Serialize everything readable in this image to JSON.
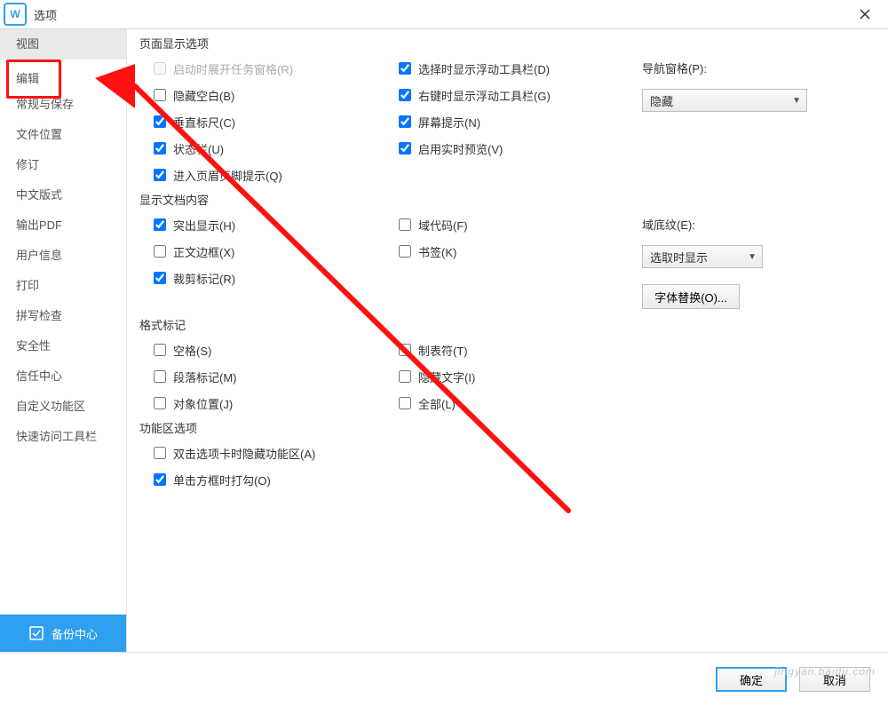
{
  "window": {
    "title": "选项"
  },
  "sidebar": {
    "items": [
      "视图",
      "编辑",
      "常规与保存",
      "文件位置",
      "修订",
      "中文版式",
      "输出PDF",
      "用户信息",
      "打印",
      "拼写检查",
      "安全性",
      "信任中心",
      "自定义功能区",
      "快速访问工具栏"
    ],
    "active_index": 0,
    "highlight_index": 1,
    "backup_label": "备份中心"
  },
  "groups": {
    "pageDisplay": {
      "title": "页面显示选项",
      "col1": [
        {
          "label": "启动时展开任务窗格(R)",
          "checked": false,
          "disabled": true
        },
        {
          "label": "隐藏空白(B)",
          "checked": false
        },
        {
          "label": "垂直标尺(C)",
          "checked": true
        },
        {
          "label": "状态栏(U)",
          "checked": true
        },
        {
          "label": "进入页眉页脚提示(Q)",
          "checked": true
        }
      ],
      "col2": [
        {
          "label": "选择时显示浮动工具栏(D)",
          "checked": true
        },
        {
          "label": "右键时显示浮动工具栏(G)",
          "checked": true
        },
        {
          "label": "屏幕提示(N)",
          "checked": true
        },
        {
          "label": "启用实时预览(V)",
          "checked": true
        }
      ],
      "navPane": {
        "label": "导航窗格(P):",
        "value": "隐藏"
      }
    },
    "docContent": {
      "title": "显示文档内容",
      "col1": [
        {
          "label": "突出显示(H)",
          "checked": true
        },
        {
          "label": "正文边框(X)",
          "checked": false
        },
        {
          "label": "裁剪标记(R)",
          "checked": true
        }
      ],
      "col2": [
        {
          "label": "域代码(F)",
          "checked": false
        },
        {
          "label": "书签(K)",
          "checked": false
        }
      ],
      "fieldShading": {
        "label": "域底纹(E):",
        "value": "选取时显示"
      },
      "fontSubstBtn": "字体替换(O)..."
    },
    "formatMarks": {
      "title": "格式标记",
      "col1": [
        {
          "label": "空格(S)",
          "checked": false
        },
        {
          "label": "段落标记(M)",
          "checked": false
        },
        {
          "label": "对象位置(J)",
          "checked": false
        }
      ],
      "col2": [
        {
          "label": "制表符(T)",
          "checked": false
        },
        {
          "label": "隐藏文字(I)",
          "checked": false
        },
        {
          "label": "全部(L)",
          "checked": false
        }
      ]
    },
    "ribbon": {
      "title": "功能区选项",
      "items": [
        {
          "label": "双击选项卡时隐藏功能区(A)",
          "checked": false
        },
        {
          "label": "单击方框时打勾(O)",
          "checked": true
        }
      ]
    }
  },
  "footer": {
    "ok": "确定",
    "cancel": "取消"
  },
  "watermark": "jingyan.baidu.com"
}
